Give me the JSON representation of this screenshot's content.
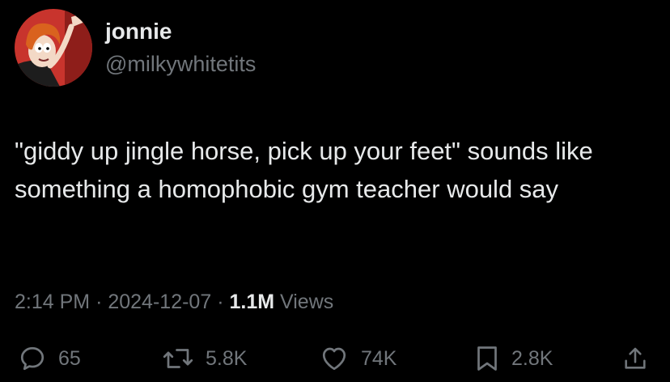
{
  "user": {
    "display_name": "jonnie",
    "handle": "@milkywhitetits",
    "avatar_icon": "cartoon-avatar"
  },
  "tweet": {
    "text": "\"giddy up jingle horse, pick up your feet\" sounds like something a homophobic gym teacher would say",
    "time": "2:14 PM",
    "date": "2024-12-07",
    "separator": "·",
    "views_count": "1.1M",
    "views_label": "Views"
  },
  "actions": {
    "reply": {
      "icon": "reply-icon",
      "count": "65"
    },
    "retweet": {
      "icon": "retweet-icon",
      "count": "5.8K"
    },
    "like": {
      "icon": "heart-icon",
      "count": "74K"
    },
    "bookmark": {
      "icon": "bookmark-icon",
      "count": "2.8K"
    },
    "share": {
      "icon": "share-icon"
    }
  },
  "colors": {
    "background": "#000000",
    "primary_text": "#e7e9ea",
    "secondary_text": "#71767b",
    "avatar_bg": "#c8342d"
  }
}
